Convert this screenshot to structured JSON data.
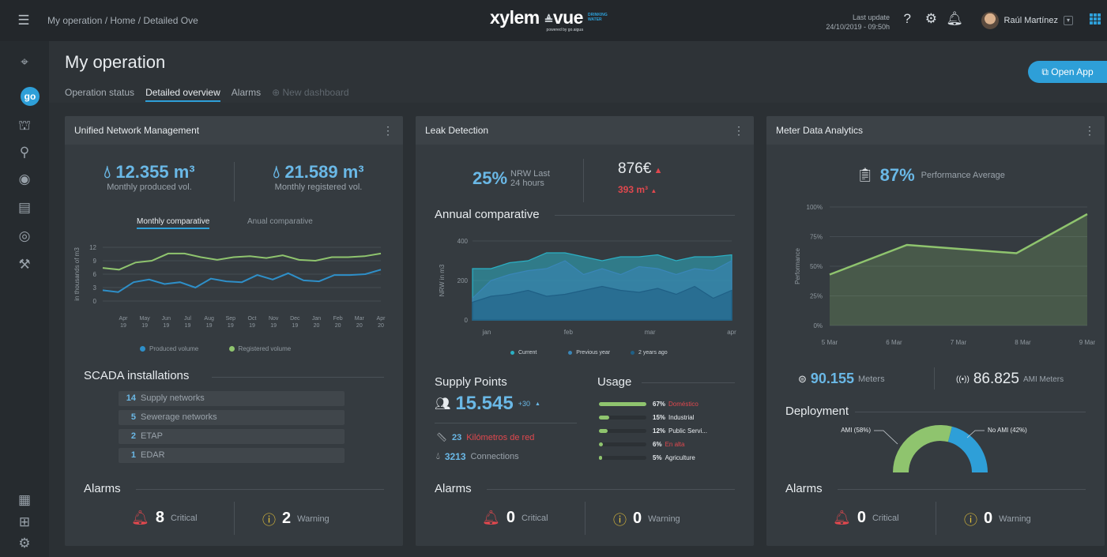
{
  "topbar": {
    "breadcrumb": "My operation / Home / Detailed Ove",
    "logo": "xylem",
    "logo_suffix": "vue",
    "powered": "powered by go.aigua",
    "logo_tag1": "DRINKING",
    "logo_tag2": "WATER",
    "last_update_label": "Last update",
    "last_update_value": "24/10/2019 - 09:50h",
    "user_name": "Raúl Martínez",
    "icons": [
      "menu-icon",
      "help-icon",
      "gear-icon",
      "bell-icon",
      "apps-grid-icon"
    ]
  },
  "sidebar": {
    "logo": "go",
    "icons": [
      "location-icon",
      "go-logo",
      "water-tower-icon",
      "pipe-icon",
      "sensor-icon",
      "meter-icon",
      "users-icon",
      "tools-icon",
      "database-icon",
      "hierarchy-icon",
      "settings-icon"
    ]
  },
  "page": {
    "title": "My operation",
    "tabs": [
      "Operation status",
      "Detailed overview",
      "Alarms",
      "New dashboard"
    ],
    "open_app": "Open App"
  },
  "unm": {
    "title": "Unified Network Management",
    "produced_value": "12.355 m³",
    "produced_label": "Monthly produced vol.",
    "registered_value": "21.589 m³",
    "registered_label": "Monthly registered vol.",
    "tab_monthly": "Monthly comparative",
    "tab_annual": "Anual comparative",
    "legend_produced": "Produced volume",
    "legend_registered": "Registered volume",
    "scada_title": "SCADA installations",
    "scada": [
      {
        "n": "14",
        "label": "Supply networks"
      },
      {
        "n": "5",
        "label": "Sewerage networks"
      },
      {
        "n": "2",
        "label": "ETAP"
      },
      {
        "n": "1",
        "label": "EDAR"
      }
    ],
    "alarms_title": "Alarms",
    "critical_n": "8",
    "critical_label": "Critical",
    "warning_n": "2",
    "warning_label": "Warning"
  },
  "leak": {
    "title": "Leak Detection",
    "nrw_pct": "25%",
    "nrw_label1": "NRW Last",
    "nrw_label2": "24 hours",
    "cost": "876€",
    "volume": "393 m³",
    "annual_title": "Annual comparative",
    "legend": [
      "Current",
      "Previous year",
      "2 years ago"
    ],
    "supply_title": "Supply Points",
    "supply_value": "15.545",
    "supply_delta": "+30",
    "km_n": "23",
    "km_label": "Kilómetros de red",
    "conn_n": "3213",
    "conn_label": "Connections",
    "usage_title": "Usage",
    "usage": [
      {
        "pct": "67%",
        "label": "Doméstico",
        "frac": 0.67,
        "red": true
      },
      {
        "pct": "15%",
        "label": "Industrial",
        "frac": 0.15,
        "red": false
      },
      {
        "pct": "12%",
        "label": "Public Servi...",
        "frac": 0.12,
        "red": false
      },
      {
        "pct": "6%",
        "label": "En alta",
        "frac": 0.06,
        "red": true
      },
      {
        "pct": "5%",
        "label": "Agriculture",
        "frac": 0.05,
        "red": false
      }
    ],
    "alarms_title": "Alarms",
    "critical_n": "0",
    "critical_label": "Critical",
    "warning_n": "0",
    "warning_label": "Warning"
  },
  "mda": {
    "title": "Meter Data Analytics",
    "perf_value": "87%",
    "perf_label": "Performance Average",
    "meters_value": "90.155",
    "meters_label": "Meters",
    "ami_value": "86.825",
    "ami_label": "AMI Meters",
    "deploy_title": "Deployment",
    "ami_label_chart": "AMI (58%)",
    "noami_label_chart": "No AMI (42%)",
    "alarms_title": "Alarms",
    "critical_n": "0",
    "critical_label": "Critical",
    "warning_n": "0",
    "warning_label": "Warning"
  },
  "chart_data": [
    {
      "type": "line",
      "ylabel": "in thousands of m3",
      "ylim": [
        0,
        12
      ],
      "yticks": [
        "12",
        "9",
        "6",
        "3",
        "0"
      ],
      "categories": [
        "Apr 19",
        "May 19",
        "Jun 19",
        "Jul 19",
        "Aug 19",
        "Sep 19",
        "Oct 19",
        "Nov 19",
        "Dec 19",
        "Jan 20",
        "Feb 20",
        "Mar 20",
        "Apr 20"
      ],
      "x": [
        0,
        0.5,
        1,
        1.5,
        2,
        2.5,
        3,
        3.5,
        4,
        4.5,
        5,
        5.5,
        6,
        6.5,
        7,
        7.5,
        8,
        8.5,
        9,
        9.5,
        10,
        10.5,
        11,
        11.5,
        12
      ],
      "series": [
        {
          "name": "Produced volume",
          "color": "#2e8fc8",
          "values": [
            2.4,
            2.0,
            4.2,
            4.8,
            3.8,
            4.2,
            3.0,
            5.0,
            4.4,
            4.2,
            5.8,
            4.8,
            6.2,
            4.6,
            4.4,
            5.8,
            5.8,
            6.0,
            7.0
          ]
        },
        {
          "name": "Registered volume",
          "color": "#8fc46e",
          "values": [
            7.4,
            7.0,
            8.6,
            9.0,
            10.6,
            10.6,
            9.8,
            9.2,
            9.8,
            10.0,
            9.6,
            10.2,
            9.2,
            9.0,
            9.8,
            9.8,
            10.0,
            10.6
          ]
        }
      ]
    },
    {
      "type": "area",
      "ylabel": "NRW in m3",
      "ylim": [
        0,
        400
      ],
      "yticks": [
        "400",
        "200",
        "0"
      ],
      "categories": [
        "jan",
        "feb",
        "mar",
        "apr"
      ],
      "series": [
        {
          "name": "Current",
          "color": "#2bb0c4",
          "values": [
            260,
            260,
            290,
            300,
            340,
            340,
            320,
            300,
            320,
            320,
            330,
            300,
            320,
            320,
            330
          ]
        },
        {
          "name": "Previous year",
          "color": "#3a86b8",
          "values": [
            110,
            200,
            230,
            250,
            260,
            300,
            230,
            260,
            230,
            270,
            260,
            230,
            260,
            250,
            300
          ]
        },
        {
          "name": "2 years ago",
          "color": "#1f5f85",
          "values": [
            90,
            120,
            130,
            150,
            120,
            130,
            150,
            170,
            150,
            140,
            160,
            130,
            170,
            110,
            150
          ]
        }
      ]
    },
    {
      "type": "line",
      "ylabel": "Performance",
      "ylim": [
        0,
        100
      ],
      "yticks": [
        "100%",
        "75%",
        "50%",
        "25%",
        "0%"
      ],
      "categories": [
        "5 Mar",
        "6 Mar",
        "7 Mar",
        "8 Mar",
        "9 Mar"
      ],
      "series": [
        {
          "name": "Performance",
          "color": "#8fc46e",
          "values": [
            43,
            68,
            null,
            61,
            94
          ]
        }
      ],
      "x": [
        0,
        1.2,
        null,
        2.9,
        4
      ]
    },
    {
      "type": "pie",
      "categories": [
        "AMI",
        "No AMI"
      ],
      "values": [
        58,
        42
      ],
      "colors": [
        "#8fc46e",
        "#2e9fd8"
      ]
    }
  ]
}
